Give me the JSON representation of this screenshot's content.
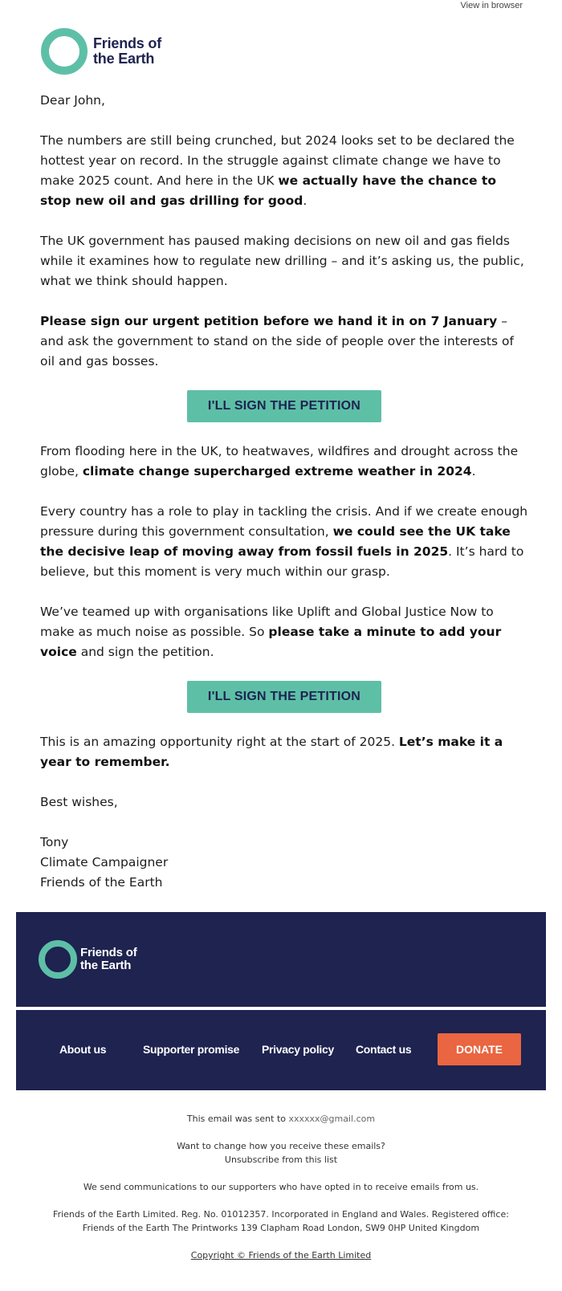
{
  "header": {
    "view_in_browser": "View in browser",
    "logo_line1": "Friends of",
    "logo_line2": "the Earth"
  },
  "body": {
    "greeting": "Dear John,",
    "p1_a": "The numbers are still being crunched, but 2024 looks set to be declared the hottest year on record. In the struggle against climate change we have to make 2025 count. And here in the UK ",
    "p1_b": "we actually have the chance to stop new oil and gas drilling for good",
    "p1_c": ".",
    "p2": "The UK government has paused making decisions on new oil and gas fields while it examines how to regulate new drilling – and it’s asking us, the public, what we think should happen.",
    "p3_a": "Please sign our urgent petition before we hand it in on 7 January",
    "p3_b": " – and ask the government to stand on the side of people over the interests of oil and gas bosses.",
    "cta_label": "I'LL SIGN THE PETITION",
    "p4_a": "From flooding here in the UK, to heatwaves, wildfires and drought across the globe, ",
    "p4_b": "climate change supercharged extreme weather in 2024",
    "p4_c": ".",
    "p5_a": "Every country has a role to play in tackling the crisis. And if we create enough pressure during this government consultation, ",
    "p5_b": "we could see the UK take the decisive leap of moving away from fossil fuels in 2025",
    "p5_c": ". It’s hard to believe, but this moment is very much within our grasp.",
    "p6_a": "We’ve teamed up with organisations like Uplift and Global Justice Now to make as much noise as possible. So ",
    "p6_b": "please take a minute to add your voice",
    "p6_c": " and sign the petition.",
    "p7_a": "This is an amazing opportunity right at the start of 2025. ",
    "p7_b": "Let’s make it a year to remember.",
    "closing": "Best wishes,",
    "sign_name": "Tony",
    "sign_role": "Climate Campaigner",
    "sign_org": "Friends of the Earth"
  },
  "footer": {
    "logo_line1": "Friends of",
    "logo_line2": "the Earth",
    "nav": {
      "about": "About us",
      "promise": "Supporter promise",
      "privacy": "Privacy policy",
      "contact": "Contact us",
      "donate": "DONATE"
    },
    "sent_prefix": "This email was sent to ",
    "sent_email": "xxxxxx@gmail.com",
    "change_q": "Want to change how you receive these emails?",
    "unsubscribe": "Unsubscribe from this list",
    "optin": "We send communications to our supporters who have opted in to receive emails from us.",
    "legal_1": "Friends of the Earth Limited. Reg. No. 01012357. Incorporated in England and Wales. Registered office:",
    "legal_2": "Friends of the Earth The Printworks 139 Clapham Road London, SW9 0HP United Kingdom",
    "copyright": "Copyright © Friends of the Earth Limited"
  },
  "colors": {
    "brand_green": "#5ebfa7",
    "navy": "#1e2350",
    "donate_orange": "#ea6541"
  }
}
